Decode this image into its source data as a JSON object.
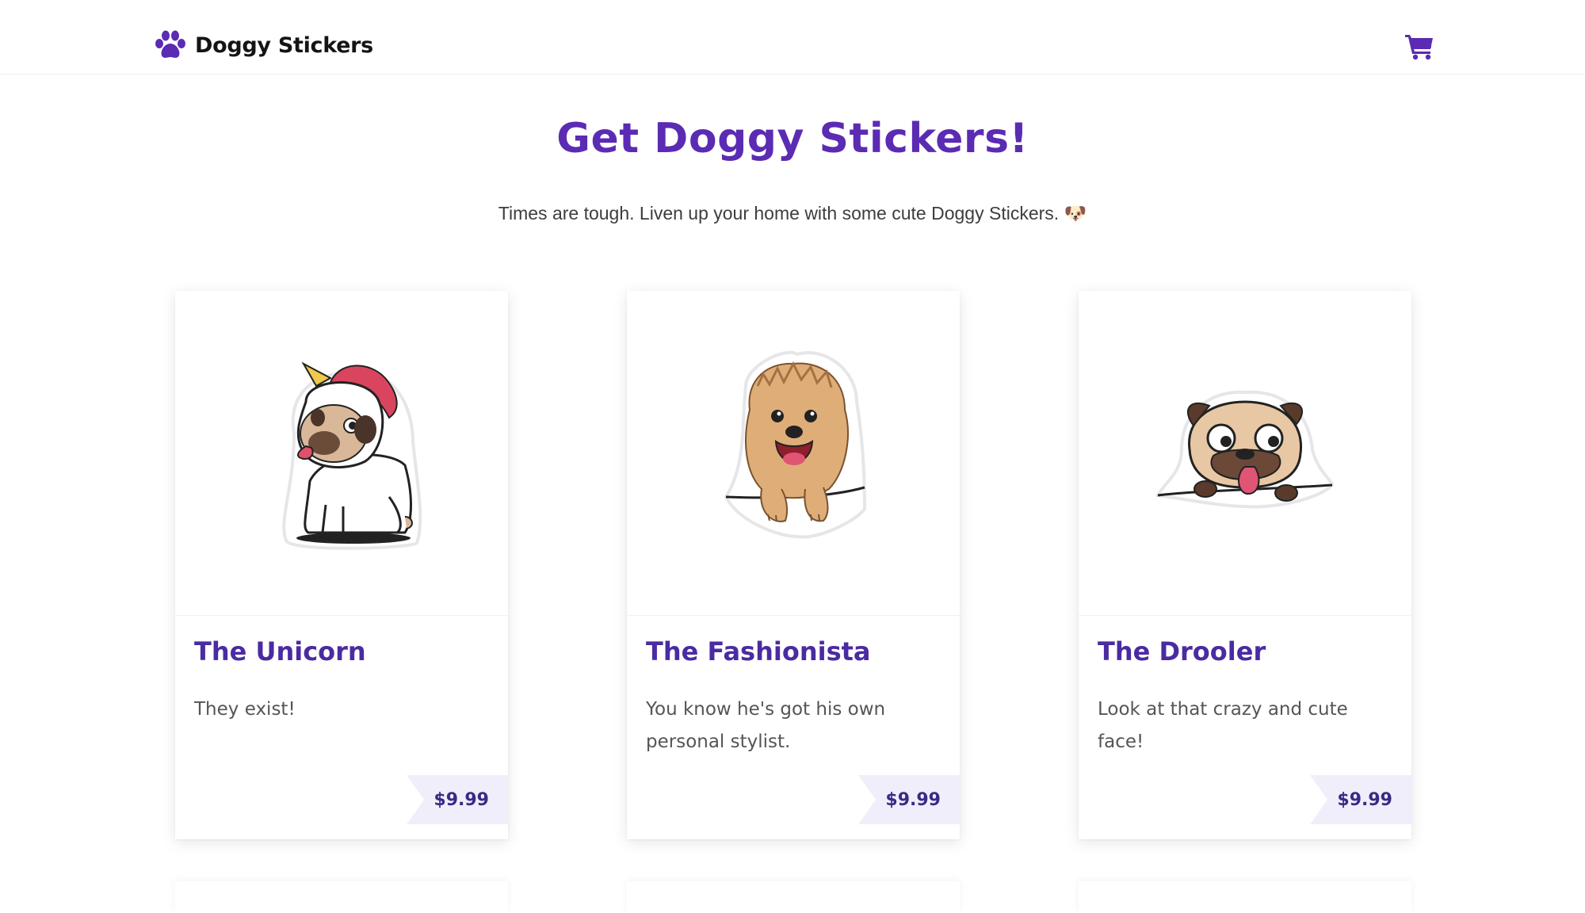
{
  "brand": {
    "name": "Doggy Stickers",
    "icon": "paw-icon",
    "color": "#5b2bb4"
  },
  "nav": {
    "cart_icon": "shopping-cart-icon"
  },
  "hero": {
    "title": "Get Doggy Stickers!",
    "subtitle": "Times are tough. Liven up your home with some cute Doggy Stickers. 🐶"
  },
  "products": [
    {
      "title": "The Unicorn",
      "description": "They exist!",
      "price": "$9.99",
      "image": "unicorn-pug-sticker"
    },
    {
      "title": "The Fashionista",
      "description": "You know he's got his own personal stylist.",
      "price": "$9.99",
      "image": "shih-tzu-sticker"
    },
    {
      "title": "The Drooler",
      "description": "Look at that crazy and cute face!",
      "price": "$9.99",
      "image": "drooling-pug-sticker"
    }
  ],
  "colors": {
    "accent": "#5b2bb4",
    "title": "#4a2ba2",
    "price_bg": "#f1eefb",
    "price_text": "#3a2a85"
  }
}
